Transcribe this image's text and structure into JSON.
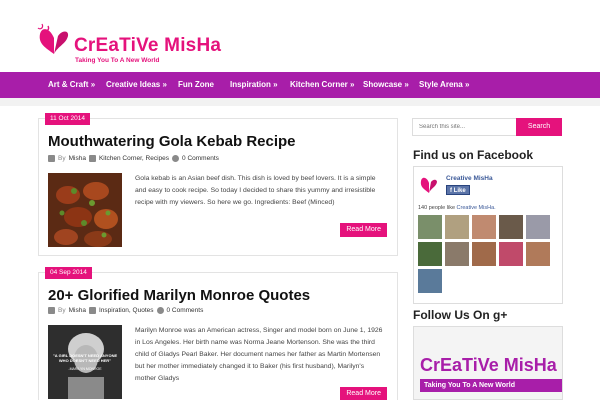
{
  "site": {
    "name": "CrEaTiVe MisHa",
    "tagline": "Taking You To A New World"
  },
  "nav": [
    {
      "label": "Art & Craft",
      "arrow": "»"
    },
    {
      "label": "Creative Ideas",
      "arrow": "»"
    },
    {
      "label": "Fun Zone",
      "arrow": ""
    },
    {
      "label": "Inspiration",
      "arrow": "»"
    },
    {
      "label": "Kitchen Corner",
      "arrow": "»"
    },
    {
      "label": "Showcase",
      "arrow": "»"
    },
    {
      "label": "Style Arena",
      "arrow": "»"
    }
  ],
  "posts": [
    {
      "date": "11 Oct 2014",
      "title": "Mouthwatering Gola Kebab Recipe",
      "by": "By",
      "author": "Misha",
      "categories": "Kitchen Corner, Recipes",
      "comments": "0 Comments",
      "excerpt": "Gola kebab is an Asian beef dish. This dish is loved by beef lovers. It is a simple and easy to cook recipe. So today I decided to share this yummy and irresistible recipe with my viewers. So here we go. Ingredients: Beef (Minced)",
      "read_more": "Read More"
    },
    {
      "date": "04 Sep 2014",
      "title": "20+ Glorified Marilyn Monroe Quotes",
      "by": "By",
      "author": "Misha",
      "categories": "Inspiration, Quotes",
      "comments": "0 Comments",
      "excerpt": "Marilyn Monroe was an American actress, Singer and model born on June 1, 1926 in Los Angeles. Her birth name was Norma Jeane Mortenson. She was the third child of Gladys Pearl Baker. Her document names her father as Martin Mortensen but her mother immediately changed it to Baker (his first husband), Marilyn's mother Gladys",
      "thumb_quote": "\"A GIRL DOESN'T NEED ANYONE WHO DOESN'T NEED HER\"",
      "thumb_attribution": "-MARILYN MONROE",
      "read_more": "Read More"
    }
  ],
  "sidebar": {
    "search_placeholder": "Search this site...",
    "search_button": "Search",
    "facebook_title": "Find us on Facebook",
    "facebook_page_name": "Creative MisHa",
    "facebook_like": "Like",
    "facebook_count_prefix": "140 people like",
    "facebook_count_link": "Creative MisHa.",
    "facebook_faces": [
      {
        "name": "",
        "color": "#7a8f6a"
      },
      {
        "name": "",
        "color": "#b0a080"
      },
      {
        "name": "",
        "color": "#c08a70"
      },
      {
        "name": "",
        "color": "#6a5a4a"
      },
      {
        "name": "",
        "color": "#9a9aa8"
      },
      {
        "name": "",
        "color": "#4a6a3a"
      },
      {
        "name": "",
        "color": "#8a7a6a"
      },
      {
        "name": "",
        "color": "#a06a4a"
      },
      {
        "name": "",
        "color": "#c04a6a"
      },
      {
        "name": "",
        "color": "#b07a5a"
      },
      {
        "name": "",
        "color": "#5a7a9a"
      }
    ],
    "gplus_title": "Follow Us On g+",
    "gplus_banner_title": "CrEaTiVe MisHa",
    "gplus_banner_tag": "Taking You To A New World"
  },
  "colors": {
    "brand_pink": "#e5127c",
    "nav_purple": "#a81ea9"
  }
}
